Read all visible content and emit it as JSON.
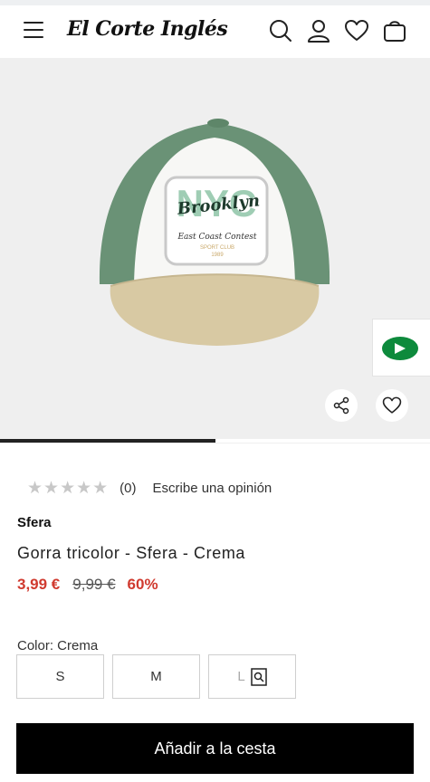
{
  "header": {
    "logo_text": "El Corte Inglés",
    "icons": [
      "menu-icon",
      "search-icon",
      "user-icon",
      "heart-icon",
      "bag-icon"
    ]
  },
  "hero": {
    "patch_main": "NYC",
    "patch_script": "Brooklyn",
    "patch_sub": "East Coast Contest",
    "patch_club": "SPORT CLUB",
    "patch_year": "1989",
    "gallery_progress": 0.5,
    "icons": [
      "share-icon",
      "heart-icon",
      "play-icon"
    ]
  },
  "product": {
    "rating": {
      "stars": "★★★★★",
      "count": "(0)",
      "write_review": "Escribe una opinión"
    },
    "brand": "Sfera",
    "title": "Gorra tricolor - Sfera - Crema",
    "price_now": "3,99 €",
    "price_old": "9,99 €",
    "discount": "60%",
    "color_label": "Color: Crema",
    "sizes": [
      "S",
      "M",
      "L"
    ]
  },
  "cta": {
    "add_to_cart": "Añadir a la cesta"
  },
  "colors": {
    "price_red": "#d03a2f",
    "cta_bg": "#000000",
    "cap_green": "#6a9276",
    "visor_beige": "#d8c9a3"
  }
}
